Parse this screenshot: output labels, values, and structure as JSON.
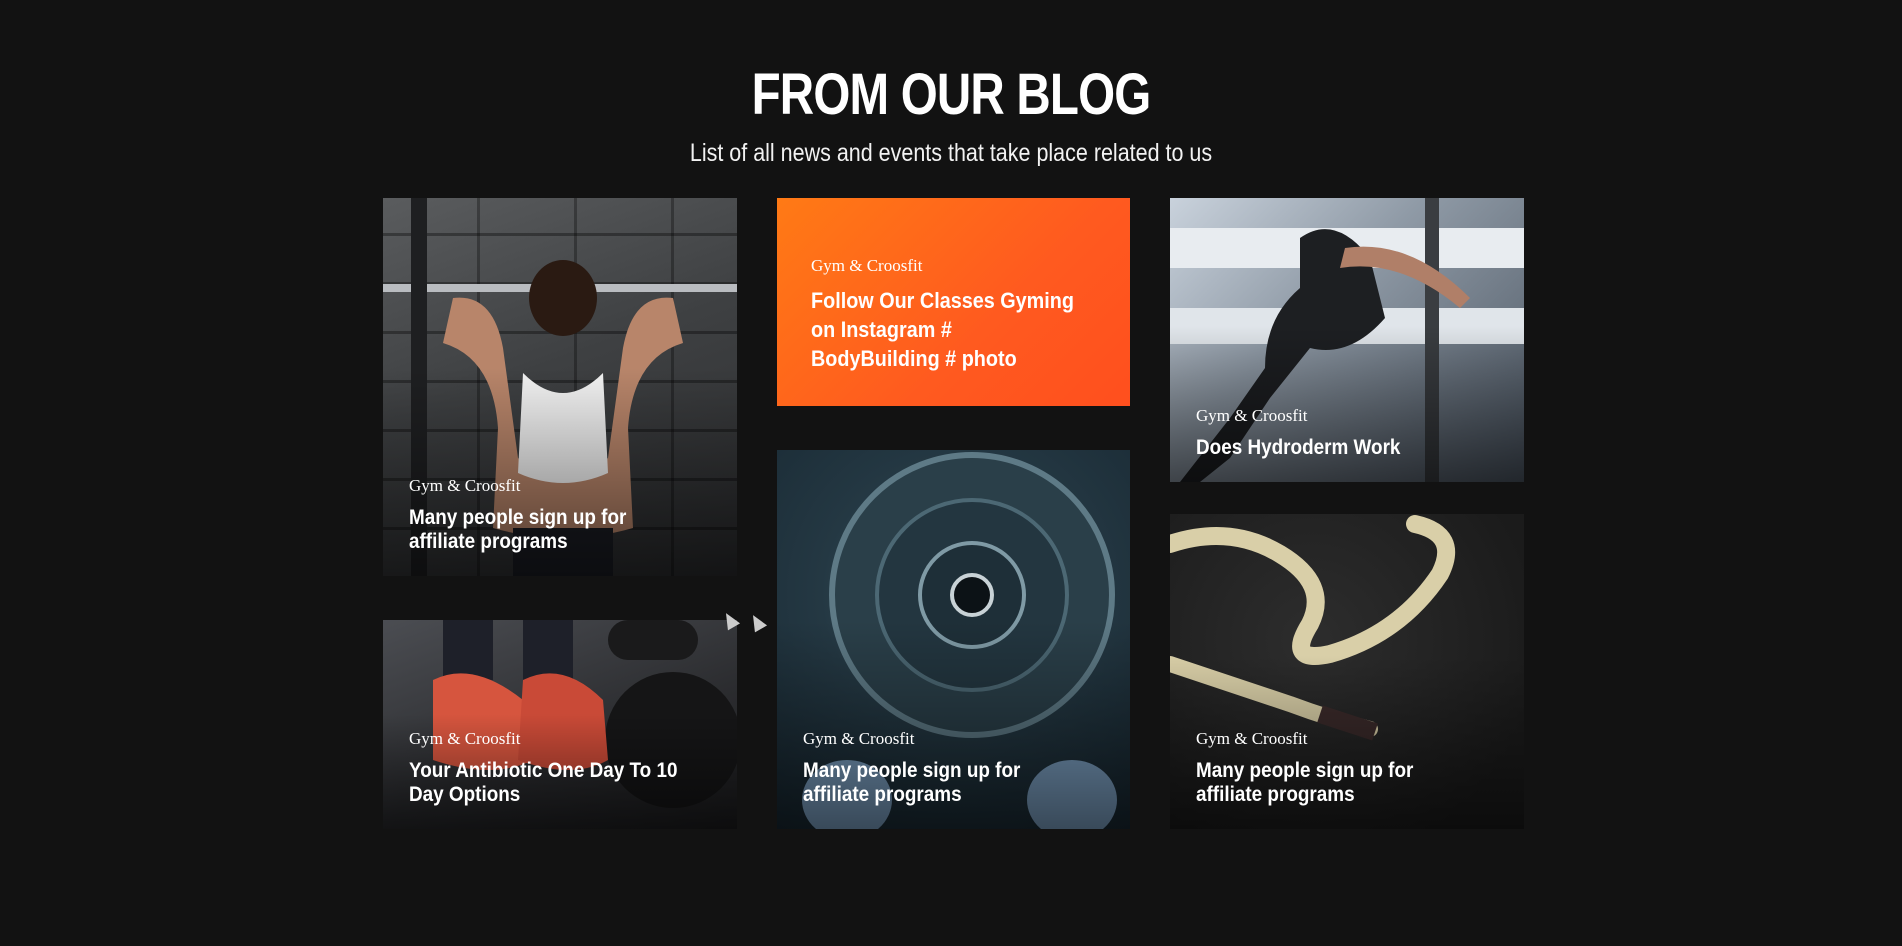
{
  "section": {
    "title": "FROM OUR BLOG",
    "subtitle": "List of all news and events that take place related to us"
  },
  "posts": [
    {
      "category": "Gym & Croosfit",
      "title": "Many people sign up for affiliate programs",
      "image": "woman-barbell-photo"
    },
    {
      "category": "Gym & Croosfit",
      "title": "Follow Our Classes Gyming on Instagram # BodyBuilding # photo",
      "image": "orange-block"
    },
    {
      "category": "Gym & Croosfit",
      "title": "Does Hydroderm Work",
      "image": "woman-training-photo"
    },
    {
      "category": "Gym & Croosfit",
      "title": "Your Antibiotic One Day To 10 Day Options",
      "image": "shoes-kettlebell-photo"
    },
    {
      "category": "Gym & Croosfit",
      "title": "Many people sign up for affiliate programs",
      "image": "weight-plate-photo"
    },
    {
      "category": "Gym & Croosfit",
      "title": "Many people sign up for affiliate programs",
      "image": "battle-rope-photo"
    }
  ],
  "colors": {
    "background": "#121212",
    "accent": "#ff6a1a",
    "text": "#ffffff"
  }
}
